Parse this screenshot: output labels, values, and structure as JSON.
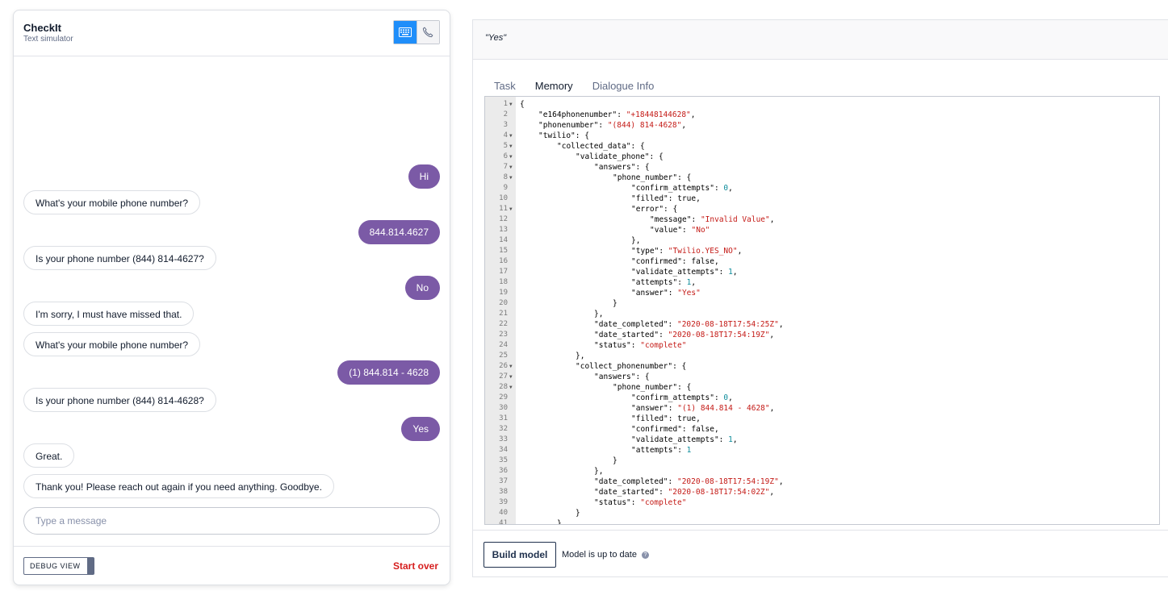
{
  "simulator": {
    "title": "CheckIt",
    "subtitle": "Text simulator",
    "messages": [
      {
        "role": "user",
        "text": "Hi"
      },
      {
        "role": "bot",
        "text": "What's your mobile phone number?"
      },
      {
        "role": "user",
        "text": "844.814.4627"
      },
      {
        "role": "bot",
        "text": "Is your phone number (844) 814-4627?"
      },
      {
        "role": "user",
        "text": "No"
      },
      {
        "role": "bot",
        "text": "I'm sorry, I must have missed that."
      },
      {
        "role": "bot",
        "text": "What's your mobile phone number?"
      },
      {
        "role": "user",
        "text": "(1) 844.814 - 4628"
      },
      {
        "role": "bot",
        "text": "Is your phone number (844) 814-4628?"
      },
      {
        "role": "user",
        "text": "Yes"
      },
      {
        "role": "bot",
        "text": "Great."
      },
      {
        "role": "bot",
        "text": "Thank you! Please reach out again if you need anything. Goodbye."
      }
    ],
    "input_placeholder": "Type a message",
    "debug_view_label": "DEBUG VIEW",
    "start_over_label": "Start over",
    "colors": {
      "user_bubble": "#7b5aa6",
      "active_mode": "#1f8efa",
      "start_over": "#d61f1f"
    }
  },
  "panel": {
    "answer": "\"Yes\"",
    "tabs": [
      {
        "label": "Task",
        "active": false
      },
      {
        "label": "Memory",
        "active": true
      },
      {
        "label": "Dialogue Info",
        "active": false
      }
    ],
    "code_lines": [
      {
        "n": "1",
        "fold": true,
        "indent": 0,
        "text": "{"
      },
      {
        "n": "2",
        "fold": false,
        "indent": 1,
        "text": "\"e164phonenumber\": \"+18448144628\","
      },
      {
        "n": "3",
        "fold": false,
        "indent": 1,
        "text": "\"phonenumber\": \"(844) 814-4628\","
      },
      {
        "n": "4",
        "fold": true,
        "indent": 1,
        "text": "\"twilio\": {"
      },
      {
        "n": "5",
        "fold": true,
        "indent": 2,
        "text": "\"collected_data\": {"
      },
      {
        "n": "6",
        "fold": true,
        "indent": 3,
        "text": "\"validate_phone\": {"
      },
      {
        "n": "7",
        "fold": true,
        "indent": 4,
        "text": "\"answers\": {"
      },
      {
        "n": "8",
        "fold": true,
        "indent": 5,
        "text": "\"phone_number\": {"
      },
      {
        "n": "9",
        "fold": false,
        "indent": 6,
        "text": "\"confirm_attempts\": 0,"
      },
      {
        "n": "10",
        "fold": false,
        "indent": 6,
        "text": "\"filled\": true,"
      },
      {
        "n": "11",
        "fold": true,
        "indent": 6,
        "text": "\"error\": {"
      },
      {
        "n": "12",
        "fold": false,
        "indent": 7,
        "text": "\"message\": \"Invalid Value\","
      },
      {
        "n": "13",
        "fold": false,
        "indent": 7,
        "text": "\"value\": \"No\""
      },
      {
        "n": "14",
        "fold": false,
        "indent": 6,
        "text": "},"
      },
      {
        "n": "15",
        "fold": false,
        "indent": 6,
        "text": "\"type\": \"Twilio.YES_NO\","
      },
      {
        "n": "16",
        "fold": false,
        "indent": 6,
        "text": "\"confirmed\": false,"
      },
      {
        "n": "17",
        "fold": false,
        "indent": 6,
        "text": "\"validate_attempts\": 1,"
      },
      {
        "n": "18",
        "fold": false,
        "indent": 6,
        "text": "\"attempts\": 1,"
      },
      {
        "n": "19",
        "fold": false,
        "indent": 6,
        "text": "\"answer\": \"Yes\""
      },
      {
        "n": "20",
        "fold": false,
        "indent": 5,
        "text": "}"
      },
      {
        "n": "21",
        "fold": false,
        "indent": 4,
        "text": "},"
      },
      {
        "n": "22",
        "fold": false,
        "indent": 4,
        "text": "\"date_completed\": \"2020-08-18T17:54:25Z\","
      },
      {
        "n": "23",
        "fold": false,
        "indent": 4,
        "text": "\"date_started\": \"2020-08-18T17:54:19Z\","
      },
      {
        "n": "24",
        "fold": false,
        "indent": 4,
        "text": "\"status\": \"complete\""
      },
      {
        "n": "25",
        "fold": false,
        "indent": 3,
        "text": "},"
      },
      {
        "n": "26",
        "fold": true,
        "indent": 3,
        "text": "\"collect_phonenumber\": {"
      },
      {
        "n": "27",
        "fold": true,
        "indent": 4,
        "text": "\"answers\": {"
      },
      {
        "n": "28",
        "fold": true,
        "indent": 5,
        "text": "\"phone_number\": {"
      },
      {
        "n": "29",
        "fold": false,
        "indent": 6,
        "text": "\"confirm_attempts\": 0,"
      },
      {
        "n": "30",
        "fold": false,
        "indent": 6,
        "text": "\"answer\": \"(1) 844.814 - 4628\","
      },
      {
        "n": "31",
        "fold": false,
        "indent": 6,
        "text": "\"filled\": true,"
      },
      {
        "n": "32",
        "fold": false,
        "indent": 6,
        "text": "\"confirmed\": false,"
      },
      {
        "n": "33",
        "fold": false,
        "indent": 6,
        "text": "\"validate_attempts\": 1,"
      },
      {
        "n": "34",
        "fold": false,
        "indent": 6,
        "text": "\"attempts\": 1"
      },
      {
        "n": "35",
        "fold": false,
        "indent": 5,
        "text": "}"
      },
      {
        "n": "36",
        "fold": false,
        "indent": 4,
        "text": "},"
      },
      {
        "n": "37",
        "fold": false,
        "indent": 4,
        "text": "\"date_completed\": \"2020-08-18T17:54:19Z\","
      },
      {
        "n": "38",
        "fold": false,
        "indent": 4,
        "text": "\"date_started\": \"2020-08-18T17:54:02Z\","
      },
      {
        "n": "39",
        "fold": false,
        "indent": 4,
        "text": "\"status\": \"complete\""
      },
      {
        "n": "40",
        "fold": false,
        "indent": 3,
        "text": "}"
      },
      {
        "n": "41",
        "fold": false,
        "indent": 2,
        "text": "}"
      }
    ],
    "build_label": "Build model",
    "model_status": "Model is up to date"
  }
}
